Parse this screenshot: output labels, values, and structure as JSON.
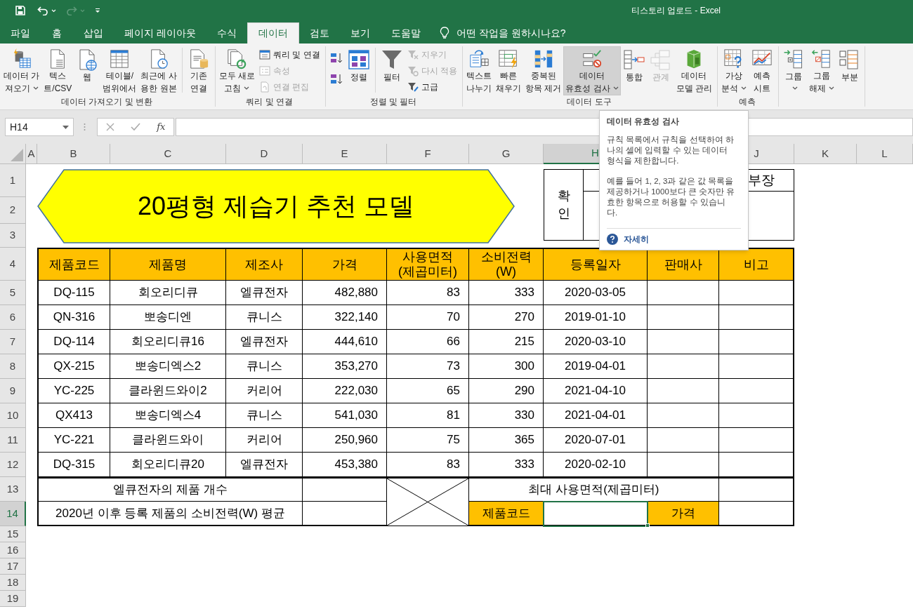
{
  "window": {
    "title": "티스토리 업로드  -  Excel"
  },
  "menu_tabs": [
    {
      "label": "파일",
      "selected": false
    },
    {
      "label": "홈",
      "selected": false
    },
    {
      "label": "삽입",
      "selected": false
    },
    {
      "label": "페이지 레이아웃",
      "selected": false
    },
    {
      "label": "수식",
      "selected": false
    },
    {
      "label": "데이터",
      "selected": true
    },
    {
      "label": "검토",
      "selected": false
    },
    {
      "label": "보기",
      "selected": false
    },
    {
      "label": "도움말",
      "selected": false
    }
  ],
  "tell_me": {
    "placeholder": "어떤 작업을 원하시나요?"
  },
  "ribbon_groups": [
    {
      "label": "데이터 가져오기 및 변환",
      "items": [
        {
          "kind": "large",
          "lines": [
            "데이터 가",
            "져오기"
          ],
          "dropdown": true,
          "disabled": false,
          "hovered": false
        },
        {
          "kind": "large",
          "lines": [
            "텍스",
            "트/CSV"
          ],
          "dropdown": false,
          "disabled": false,
          "hovered": false
        },
        {
          "kind": "large",
          "lines": [
            "웹"
          ],
          "dropdown": false,
          "disabled": false,
          "hovered": false
        },
        {
          "kind": "large",
          "lines": [
            "테이블/",
            "범위에서"
          ],
          "dropdown": false,
          "disabled": false,
          "hovered": false
        },
        {
          "kind": "large",
          "lines": [
            "최근에 사",
            "용한 원본"
          ],
          "dropdown": false,
          "disabled": false,
          "hovered": false
        },
        {
          "kind": "separator"
        },
        {
          "kind": "large",
          "lines": [
            "기존",
            "연결"
          ],
          "dropdown": false,
          "disabled": false,
          "hovered": false
        }
      ]
    },
    {
      "label": "쿼리 및 연결",
      "items": [
        {
          "kind": "large",
          "lines": [
            "모두 새로",
            "고침"
          ],
          "dropdown": true,
          "disabled": false,
          "hovered": false
        },
        {
          "kind": "stack",
          "items": [
            {
              "label": "쿼리 및 연결",
              "disabled": false
            },
            {
              "label": "속성",
              "disabled": true
            },
            {
              "label": "연결 편집",
              "disabled": true
            }
          ]
        }
      ]
    },
    {
      "label": "정렬 및 필터",
      "items": [
        {
          "kind": "sort_icons"
        },
        {
          "kind": "large",
          "lines": [
            "정렬"
          ],
          "dropdown": false,
          "disabled": false,
          "hovered": false
        },
        {
          "kind": "separator"
        },
        {
          "kind": "large",
          "lines": [
            "필터"
          ],
          "dropdown": false,
          "disabled": false,
          "hovered": false
        },
        {
          "kind": "stack",
          "items": [
            {
              "label": "지우기",
              "disabled": true
            },
            {
              "label": "다시 적용",
              "disabled": true
            },
            {
              "label": "고급",
              "disabled": false
            }
          ]
        }
      ]
    },
    {
      "label": "데이터 도구",
      "items": [
        {
          "kind": "large",
          "lines": [
            "텍스트",
            "나누기"
          ],
          "dropdown": false,
          "disabled": false,
          "hovered": false
        },
        {
          "kind": "large",
          "lines": [
            "빠른",
            "채우기"
          ],
          "dropdown": false,
          "disabled": false,
          "hovered": false
        },
        {
          "kind": "large",
          "lines": [
            "중복된",
            "항목 제거"
          ],
          "dropdown": false,
          "disabled": false,
          "hovered": false
        },
        {
          "kind": "large",
          "lines": [
            "데이터",
            "유효성 검사"
          ],
          "dropdown": true,
          "disabled": false,
          "hovered": true
        },
        {
          "kind": "large",
          "lines": [
            "통합"
          ],
          "dropdown": false,
          "disabled": false,
          "hovered": false
        },
        {
          "kind": "large",
          "lines": [
            "관계"
          ],
          "dropdown": false,
          "disabled": true,
          "hovered": false
        },
        {
          "kind": "large",
          "lines": [
            "데이터",
            "모델 관리"
          ],
          "dropdown": false,
          "disabled": false,
          "hovered": false
        }
      ]
    },
    {
      "label": "예측",
      "items": [
        {
          "kind": "large",
          "lines": [
            "가상",
            "분석"
          ],
          "dropdown": true,
          "disabled": false,
          "hovered": false
        },
        {
          "kind": "large",
          "lines": [
            "예측",
            "시트"
          ],
          "dropdown": false,
          "disabled": false,
          "hovered": false
        }
      ]
    },
    {
      "items": [
        {
          "kind": "large",
          "lines": [
            "그룹"
          ],
          "dropdown": true,
          "disabled": false,
          "hovered": false
        },
        {
          "kind": "large",
          "lines": [
            "그룹",
            "해제"
          ],
          "dropdown": true,
          "disabled": false,
          "hovered": false
        },
        {
          "kind": "large",
          "lines": [
            "부분"
          ],
          "dropdown": false,
          "disabled": false,
          "hovered": false
        }
      ]
    }
  ],
  "formula_bar": {
    "name_box": "H14",
    "function_label": "fx"
  },
  "column_headers": [
    {
      "label": "A",
      "selected": false
    },
    {
      "label": "B",
      "selected": false
    },
    {
      "label": "C",
      "selected": false
    },
    {
      "label": "D",
      "selected": false
    },
    {
      "label": "E",
      "selected": false
    },
    {
      "label": "F",
      "selected": false
    },
    {
      "label": "G",
      "selected": false
    },
    {
      "label": "H",
      "selected": true
    },
    {
      "label": "J",
      "selected": false
    },
    {
      "label": "K",
      "selected": false
    },
    {
      "label": "L",
      "selected": false
    }
  ],
  "row_headers": [
    {
      "label": "1",
      "selected": false
    },
    {
      "label": "2",
      "selected": false
    },
    {
      "label": "3",
      "selected": false
    },
    {
      "label": "4",
      "selected": false
    },
    {
      "label": "5",
      "selected": false
    },
    {
      "label": "6",
      "selected": false
    },
    {
      "label": "7",
      "selected": false
    },
    {
      "label": "8",
      "selected": false
    },
    {
      "label": "9",
      "selected": false
    },
    {
      "label": "10",
      "selected": false
    },
    {
      "label": "11",
      "selected": false
    },
    {
      "label": "12",
      "selected": false
    },
    {
      "label": "13",
      "selected": false
    },
    {
      "label": "14",
      "selected": true
    },
    {
      "label": "15",
      "selected": false
    },
    {
      "label": "16",
      "selected": false
    },
    {
      "label": "17",
      "selected": false
    },
    {
      "label": "18",
      "selected": false
    },
    {
      "label": "19",
      "selected": false
    }
  ],
  "sheet_title": "20평형 제습기 추천 모델",
  "approval": {
    "confirm": "확인",
    "position": "부장"
  },
  "table": {
    "columns": [
      {
        "lines": [
          "제품코드"
        ]
      },
      {
        "lines": [
          "제품명"
        ]
      },
      {
        "lines": [
          "제조사"
        ]
      },
      {
        "lines": [
          "가격"
        ]
      },
      {
        "lines": [
          "사용면적",
          "(제곱미터)"
        ]
      },
      {
        "lines": [
          "소비전력",
          "(W)"
        ]
      },
      {
        "lines": [
          "등록일자"
        ]
      },
      {
        "lines": [
          "판매사"
        ]
      },
      {
        "lines": [
          "비고"
        ]
      }
    ],
    "rows": [
      {
        "code": "DQ-115",
        "name": "회오리디큐",
        "maker": "엘큐전자",
        "price": "482,880",
        "area": "83",
        "power": "333",
        "date": "2020-03-05"
      },
      {
        "code": "QN-316",
        "name": "뽀송디엔",
        "maker": "큐니스",
        "price": "322,140",
        "area": "70",
        "power": "270",
        "date": "2019-01-10"
      },
      {
        "code": "DQ-114",
        "name": "회오리디큐16",
        "maker": "엘큐전자",
        "price": "444,610",
        "area": "66",
        "power": "215",
        "date": "2020-03-10"
      },
      {
        "code": "QX-215",
        "name": "뽀송디엑스2",
        "maker": "큐니스",
        "price": "353,270",
        "area": "73",
        "power": "300",
        "date": "2019-04-01"
      },
      {
        "code": "YC-225",
        "name": "클라윈드와이2",
        "maker": "커리어",
        "price": "222,030",
        "area": "65",
        "power": "290",
        "date": "2021-04-10"
      },
      {
        "code": "QX413",
        "name": "뽀송디엑스4",
        "maker": "큐니스",
        "price": "541,030",
        "area": "81",
        "power": "330",
        "date": "2021-04-01"
      },
      {
        "code": "YC-221",
        "name": "클라윈드와이",
        "maker": "커리어",
        "price": "250,960",
        "area": "75",
        "power": "365",
        "date": "2020-07-01"
      },
      {
        "code": "DQ-315",
        "name": "회오리디큐20",
        "maker": "엘큐전자",
        "price": "453,380",
        "area": "83",
        "power": "333",
        "date": "2020-02-10"
      }
    ]
  },
  "summary": {
    "count_label": "엘큐전자의 제품 개수",
    "average_label": "2020년 이후 등록 제품의 소비전력(W) 평균",
    "max_area_label": "최대 사용면적(제곱미터)",
    "code_label": "제품코드",
    "code_value_selected": true,
    "price_label": "가격"
  },
  "tooltip": {
    "title": "데이터 유효성 검사",
    "paragraphs": [
      "규칙 목록에서 규칙을 선택하여 하나의 셀에 입력할 수 있는 데이터 형식을 제한합니다.",
      "예를 들어 1, 2, 3과 같은 값 목록을 제공하거나 1000보다 큰 숫자만 유효한 항목으로 허용할 수 있습니다."
    ],
    "link": "자세히"
  }
}
